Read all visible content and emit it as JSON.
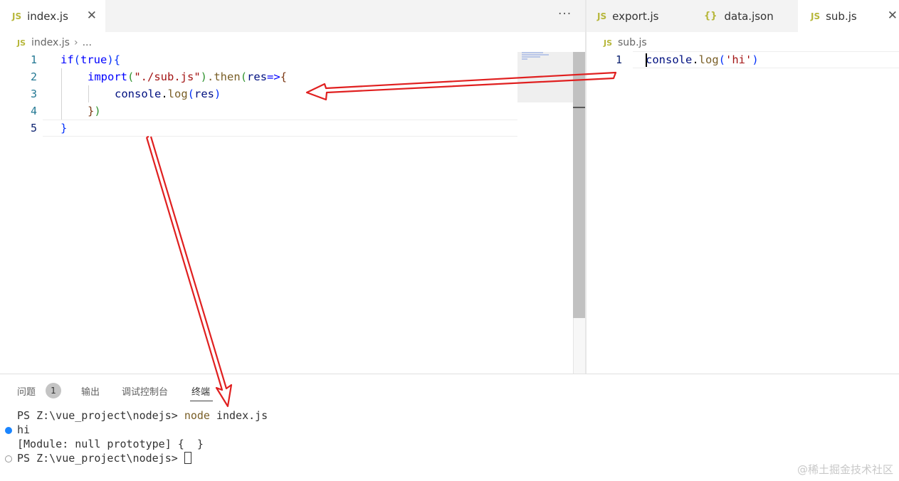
{
  "left_editor": {
    "tabs": [
      {
        "label": "index.js",
        "icon": "js-file-icon",
        "active": true
      }
    ],
    "more_actions": "···",
    "breadcrumb": {
      "file": "index.js",
      "rest": "..."
    },
    "line_numbers": [
      "1",
      "2",
      "3",
      "4",
      "5"
    ],
    "code": {
      "l1": {
        "kw": "if",
        "open": "(",
        "val": "true",
        "close": ")",
        "brace": "{"
      },
      "l2": {
        "fn": "import",
        "open": "(",
        "str": "\"./sub.js\"",
        "close": ")",
        "dot_then": ".then",
        "open2": "(",
        "param": "res",
        "arrow": "=>",
        "brace": "{"
      },
      "l3": {
        "obj": "console",
        "dot": ".",
        "fn": "log",
        "open": "(",
        "arg": "res",
        "close": ")"
      },
      "l4": {
        "brace": "}",
        "close": ")"
      },
      "l5": {
        "brace": "}"
      }
    }
  },
  "right_editor": {
    "tabs": [
      {
        "label": "export.js",
        "icon": "js-file-icon"
      },
      {
        "label": "data.json",
        "icon": "json-file-icon",
        "glyph": "{}"
      },
      {
        "label": "sub.js",
        "icon": "js-file-icon",
        "active": true
      }
    ],
    "breadcrumb": {
      "file": "sub.js"
    },
    "line_numbers": [
      "1"
    ],
    "code": {
      "obj": "console",
      "dot": ".",
      "fn": "log",
      "open": "(",
      "str": "'hi'",
      "close": ")"
    }
  },
  "panel": {
    "tabs": {
      "problems": "问题",
      "output": "输出",
      "debug_console": "调试控制台",
      "terminal": "终端"
    },
    "problems_count": "1",
    "terminal": {
      "line1_prompt": "PS Z:\\vue_project\\nodejs> ",
      "line1_cmd": "node",
      "line1_arg": " index.js",
      "line2": "hi",
      "line3": "[Module: null prototype] {  }",
      "line4_prompt": "PS Z:\\vue_project\\nodejs> "
    }
  },
  "watermark": "@稀土掘金技术社区",
  "colors": {
    "annotation_arrow": "#e02020",
    "js_icon": "#b7b73b",
    "keyword": "#0000ff",
    "string": "#a31515"
  }
}
